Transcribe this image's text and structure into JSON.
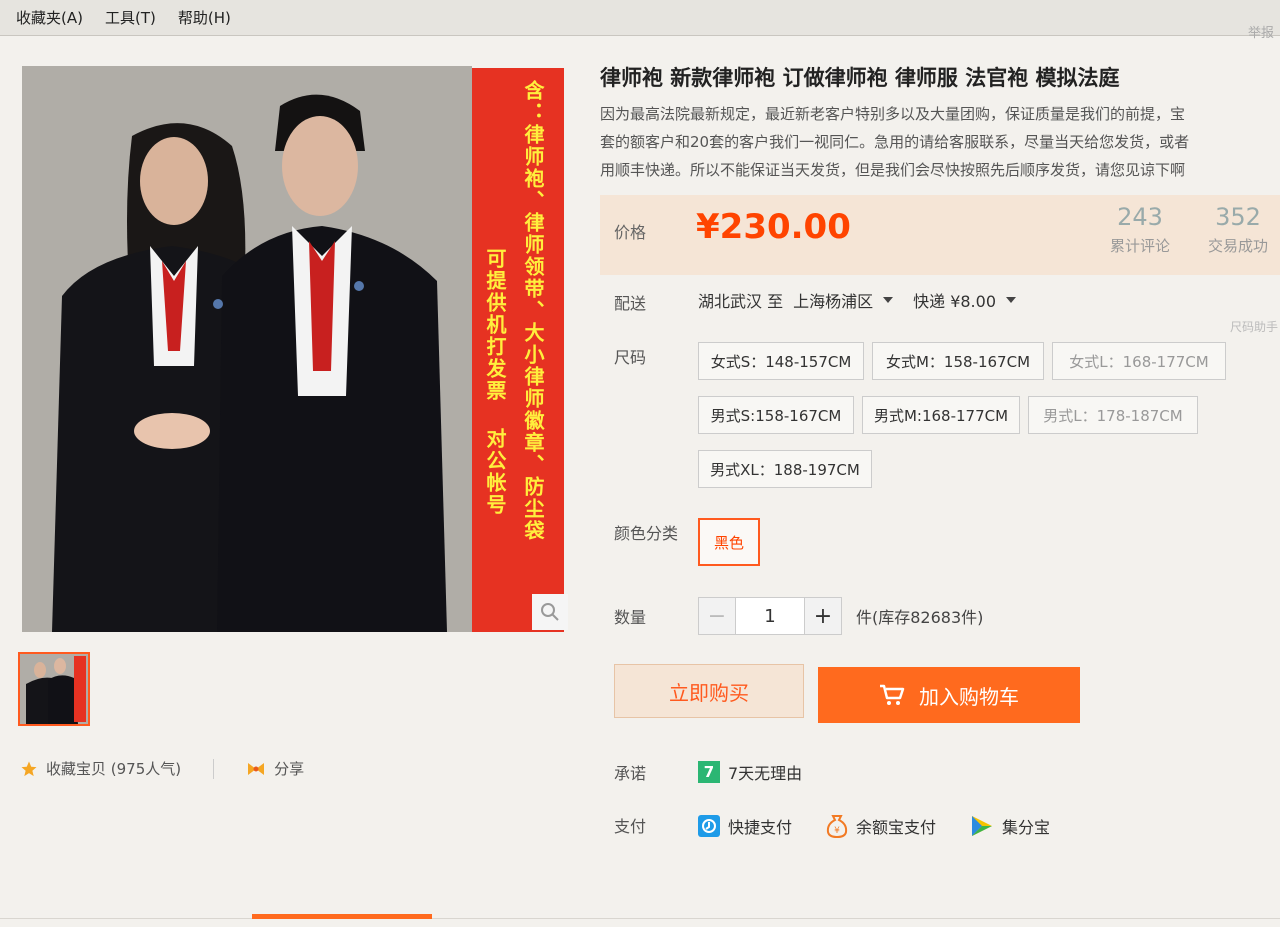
{
  "menu": {
    "favorites": "收藏夹(A)",
    "tools": "工具(T)",
    "help": "帮助(H)"
  },
  "corner_text": "举报",
  "banner": {
    "col1": "含：律师袍、律师领带、大小律师徽章、防尘袋",
    "col2": "可提供机打发票 对公帐号"
  },
  "product": {
    "title": "律师袍 新款律师袍 订做律师袍 律师服 法官袍 模拟法庭",
    "desc_lines": [
      "因为最高法院最新规定，最近新老客户特别多以及大量团购，保证质量是我们的前提，宝",
      "套的额客户和20套的客户我们一视同仁。急用的请给客服联系，尽量当天给您发货，或者",
      "用顺丰快递。所以不能保证当天发货，但是我们会尽快按照先后顺序发货，请您见谅下啊"
    ]
  },
  "price": {
    "label": "价格",
    "value": "¥230.00",
    "reviews_count": "243",
    "reviews_label": "累计评论",
    "sales_count": "352",
    "sales_label": "交易成功"
  },
  "shipping": {
    "label": "配送",
    "from": "湖北武汉 至",
    "to": "上海杨浦区",
    "method": "快递 ¥8.00"
  },
  "size": {
    "label": "尺码",
    "hint": "尺码助手",
    "options": [
      "女式S：148-157CM",
      "女式M：158-167CM",
      "女式L：168-177CM",
      "男式S:158-167CM",
      "男式M:168-177CM",
      "男式L：178-187CM",
      "男式XL：188-197CM"
    ]
  },
  "color": {
    "label": "颜色分类",
    "selected": "黑色"
  },
  "quantity": {
    "label": "数量",
    "minus": "−",
    "value": "1",
    "plus": "+",
    "stock": "件(库存82683件)"
  },
  "actions": {
    "buy_now": "立即购买",
    "add_to_cart": "加入购物车"
  },
  "promise": {
    "label": "承诺",
    "icon_text": "7",
    "text": "7天无理由"
  },
  "payment": {
    "label": "支付",
    "methods": [
      "快捷支付",
      "余额宝支付",
      "集分宝"
    ]
  },
  "social": {
    "favorite": "收藏宝贝 (975人气)",
    "share": "分享"
  },
  "colors": {
    "accent": "#ff4400",
    "cart_button": "#ff6a1e",
    "banner_red": "#e63222",
    "banner_text": "#ffef3d"
  }
}
